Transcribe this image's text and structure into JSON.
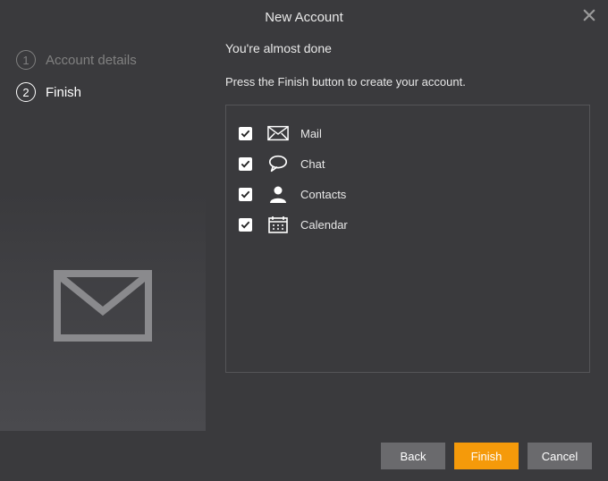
{
  "title": "New Account",
  "steps": [
    {
      "num": "1",
      "label": "Account details",
      "active": false
    },
    {
      "num": "2",
      "label": "Finish",
      "active": true
    }
  ],
  "main": {
    "subtitle": "You're almost done",
    "instruction": "Press the Finish button to create your account."
  },
  "services": [
    {
      "label": "Mail",
      "checked": true
    },
    {
      "label": "Chat",
      "checked": true
    },
    {
      "label": "Contacts",
      "checked": true
    },
    {
      "label": "Calendar",
      "checked": true
    }
  ],
  "buttons": {
    "back": "Back",
    "finish": "Finish",
    "cancel": "Cancel"
  }
}
